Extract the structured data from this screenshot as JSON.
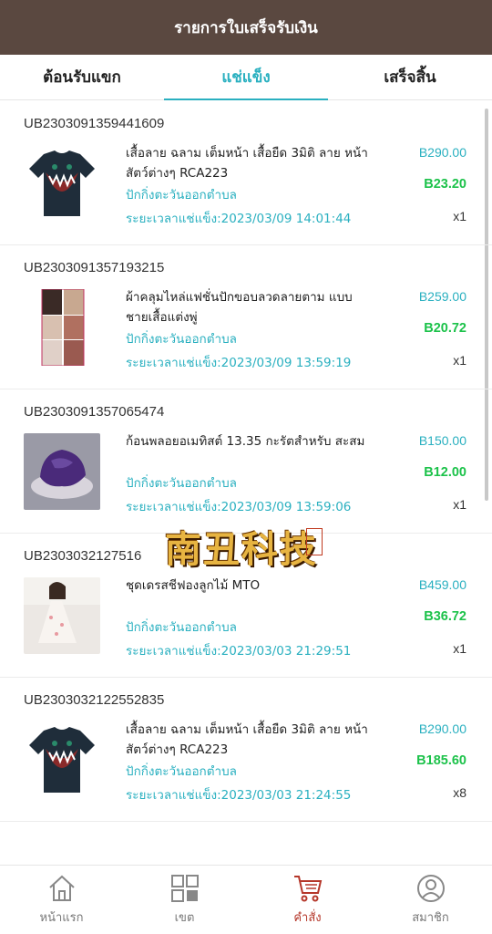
{
  "header": {
    "title": "รายการใบเสร็จรับเงิน"
  },
  "tabs": [
    {
      "label": "ต้อนรับแขก",
      "active": false
    },
    {
      "label": "แช่แข็ง",
      "active": true
    },
    {
      "label": "เสร็จสิ้น",
      "active": false
    }
  ],
  "orders": [
    {
      "id": "UB2303091359441609",
      "name": "เสื้อลาย ฉลาม เต็มหน้า เสื้อยืด 3มิติ ลาย หน้าสัตว์ต่างๆ RCA223",
      "shop": "ปักกิ่งตะวันออกตำบล",
      "time": "ระยะเวลาแช่แข็ง:2023/03/09 14:01:44",
      "price": "B290.00",
      "commission": "B23.20",
      "qty": "x1",
      "image": "shark-tshirt"
    },
    {
      "id": "UB2303091357193215",
      "name": "ผ้าคลุมไหล่แฟชั่นปักขอบลวดลายตาม แบบ ชายเสื้อแต่งพู่",
      "shop": "ปักกิ่งตะวันออกตำบล",
      "time": "ระยะเวลาแช่แข็ง:2023/03/09 13:59:19",
      "price": "B259.00",
      "commission": "B20.72",
      "qty": "x1",
      "image": "shawl-collage"
    },
    {
      "id": "UB2303091357065474",
      "name": "ก้อนพลอยอเมทิสต์ 13.35 กะรัตสำหรับ สะสม",
      "shop": "ปักกิ่งตะวันออกตำบล",
      "time": "ระยะเวลาแช่แข็ง:2023/03/09 13:59:06",
      "price": "B150.00",
      "commission": "B12.00",
      "qty": "x1",
      "image": "amethyst-gem"
    },
    {
      "id": "UB2303032127516",
      "name": "ชุดเดรสชีฟองลูกไม้ MTO",
      "shop": "ปักกิ่งตะวันออกตำบล",
      "time": "ระยะเวลาแช่แข็ง:2023/03/03 21:29:51",
      "price": "B459.00",
      "commission": "B36.72",
      "qty": "x1",
      "image": "chiffon-dress"
    },
    {
      "id": "UB2303032122552835",
      "name": "เสื้อลาย ฉลาม เต็มหน้า เสื้อยืด 3มิติ ลาย หน้าสัตว์ต่างๆ RCA223",
      "shop": "ปักกิ่งตะวันออกตำบล",
      "time": "ระยะเวลาแช่แข็ง:2023/03/03 21:24:55",
      "price": "B290.00",
      "commission": "B185.60",
      "qty": "x8",
      "image": "shark-tshirt"
    }
  ],
  "watermark": {
    "text": "南丑科技"
  },
  "nav": [
    {
      "label": "หน้าแรก",
      "icon": "home-icon",
      "active": false
    },
    {
      "label": "เขต",
      "icon": "grid-icon",
      "active": false
    },
    {
      "label": "คำสั่ง",
      "icon": "cart-icon",
      "active": true
    },
    {
      "label": "สมาชิก",
      "icon": "user-icon",
      "active": false
    }
  ],
  "colors": {
    "header_bg": "#5a4840",
    "accent": "#2ab0c0",
    "commission": "#1cc24a",
    "nav_active": "#b5372a"
  }
}
